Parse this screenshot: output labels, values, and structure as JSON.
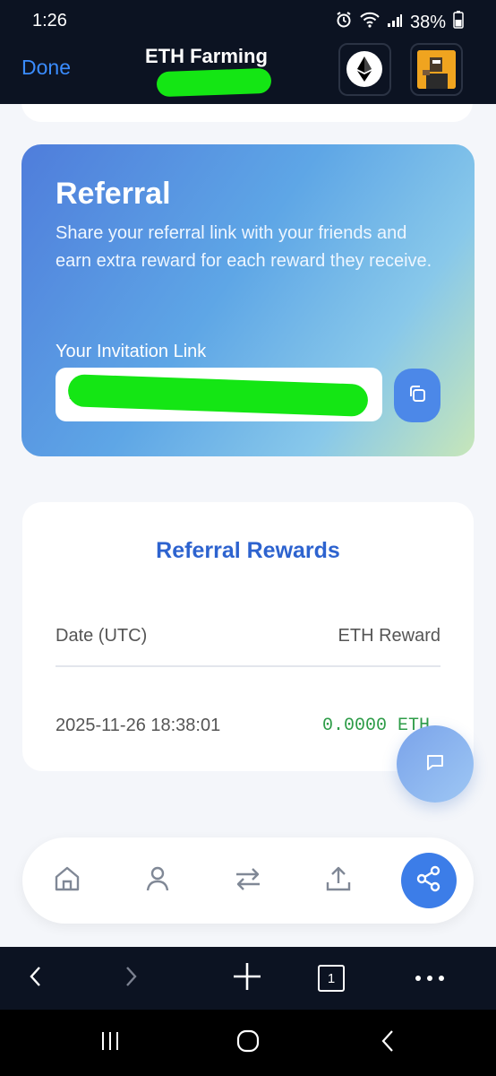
{
  "status_bar": {
    "time": "1:26",
    "battery": "38%"
  },
  "browser_header": {
    "done_label": "Done",
    "title": "ETH Farming"
  },
  "referral": {
    "title": "Referral",
    "description": "Share your referral link with your friends and earn extra reward for each reward they receive.",
    "invite_label": "Your Invitation Link",
    "invite_value": "https://"
  },
  "rewards": {
    "title": "Referral Rewards",
    "columns": [
      "Date (UTC)",
      "ETH Reward"
    ],
    "rows": [
      {
        "date": "2025-11-26 18:38:01",
        "reward": "0.0000 ETH"
      }
    ]
  },
  "bottom_nav": {
    "items": [
      "home-icon",
      "user-icon",
      "swap-icon",
      "upload-icon",
      "share-icon"
    ],
    "active": "share-icon"
  },
  "browser_toolbar": {
    "tab_count": "1"
  },
  "colors": {
    "accent": "#3c7de8",
    "title_blue": "#2d63cf",
    "reward_green": "#2e9c48",
    "dark_bar": "#0c1322"
  }
}
